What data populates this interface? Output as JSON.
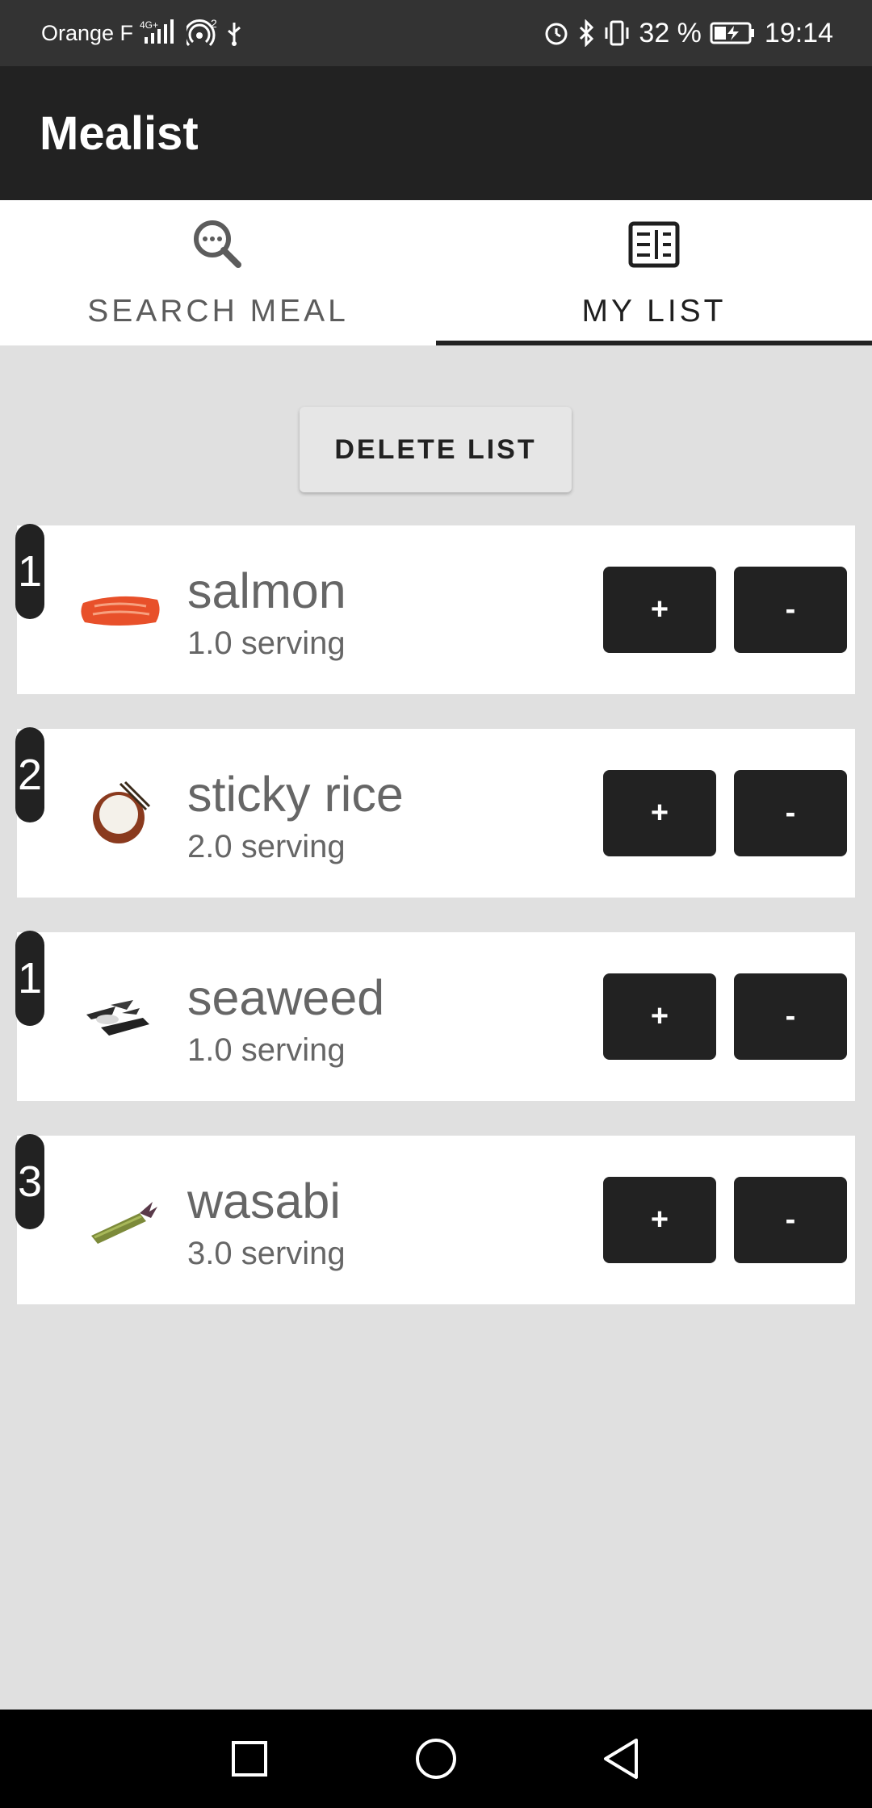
{
  "status_bar": {
    "carrier": "Orange F",
    "network": "4G+",
    "hotspot_count": "2",
    "battery": "32 %",
    "time": "19:14",
    "icons": [
      "signal-icon",
      "hotspot-icon",
      "usb-icon",
      "alarm-icon",
      "bluetooth-icon",
      "vibrate-icon",
      "battery-charging-icon"
    ]
  },
  "app_bar": {
    "title": "Mealist"
  },
  "tabs": [
    {
      "label": "SEARCH MEAL",
      "icon": "search-icon",
      "active": false
    },
    {
      "label": "MY LIST",
      "icon": "list-icon",
      "active": true
    }
  ],
  "actions": {
    "delete_label": "DELETE LIST"
  },
  "meals": [
    {
      "count": "1",
      "name": "salmon",
      "serving": "1.0 serving",
      "image": "salmon-image"
    },
    {
      "count": "2",
      "name": "sticky rice",
      "serving": "2.0 serving",
      "image": "sticky-rice-image"
    },
    {
      "count": "1",
      "name": "seaweed",
      "serving": "1.0 serving",
      "image": "seaweed-image"
    },
    {
      "count": "3",
      "name": "wasabi",
      "serving": "3.0 serving",
      "image": "wasabi-image"
    }
  ],
  "buttons": {
    "plus": "+",
    "minus": "-"
  },
  "colors": {
    "app_bar": "#222222",
    "status_bar": "#333333",
    "background": "#e0e0e0",
    "button": "#222222"
  },
  "nav": [
    "recents-icon",
    "home-icon",
    "back-icon"
  ]
}
